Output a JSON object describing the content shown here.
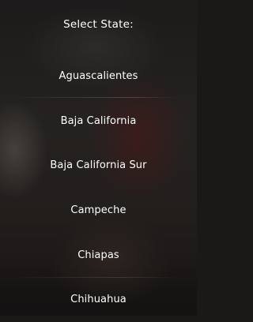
{
  "header": {
    "title": "Select State:"
  },
  "states": [
    {
      "label": "Aguascalientes"
    },
    {
      "label": "Baja California"
    },
    {
      "label": "Baja California Sur"
    },
    {
      "label": "Campeche"
    },
    {
      "label": "Chiapas"
    },
    {
      "label": "Chihuahua"
    }
  ],
  "colors": {
    "text": "#ffffff",
    "divider_accent": "#be3732",
    "background": "#1b1918"
  }
}
